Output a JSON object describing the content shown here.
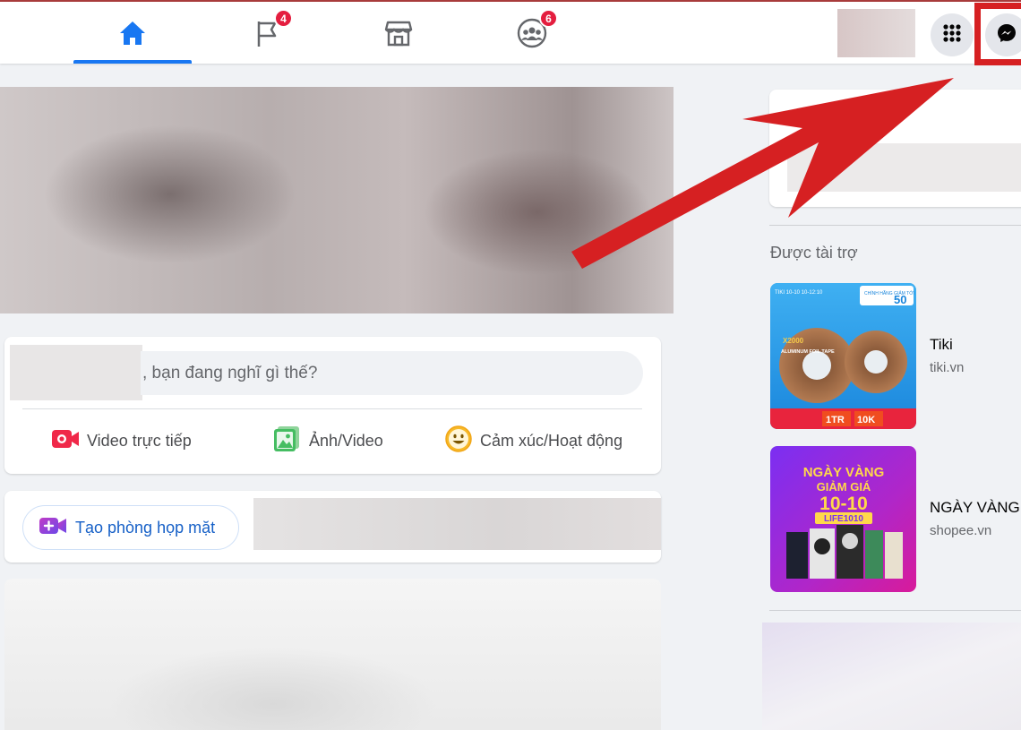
{
  "nav": {
    "tabs": [
      {
        "name": "home",
        "badge": ""
      },
      {
        "name": "pages",
        "badge": "4"
      },
      {
        "name": "marketplace",
        "badge": ""
      },
      {
        "name": "groups",
        "badge": "6"
      }
    ]
  },
  "composer": {
    "placeholder": ", bạn đang nghĩ gì thế?",
    "actions": {
      "live_video": "Video trực tiếp",
      "photo_video": "Ảnh/Video",
      "feeling": "Cảm xúc/Hoạt động"
    }
  },
  "rooms": {
    "create_label": "Tạo phòng họp mặt"
  },
  "sidebar": {
    "sponsored_heading": "Được tài trợ",
    "ads": [
      {
        "name": "Tiki",
        "domain": "tiki.vn",
        "image": {
          "corner_text": "TIKI 10-10 10-12:10",
          "badge_small": "CHÍNH HÃNG GIẢM TỚI",
          "badge_big": "50",
          "product_text": "ALUMINUM FOIL TAPE",
          "brand": "X2000",
          "footer": [
            "1TR",
            "10K"
          ]
        }
      },
      {
        "name": "NGÀY VÀNG",
        "domain": "shopee.vn",
        "image": {
          "line1": "NGÀY VÀNG",
          "line2": "GIẢM GIÁ",
          "line3": "10-10",
          "code": "LIFE1010"
        }
      }
    ]
  },
  "colors": {
    "accent": "#1877f2",
    "badge": "#e41e3f",
    "highlight": "#d62022"
  }
}
